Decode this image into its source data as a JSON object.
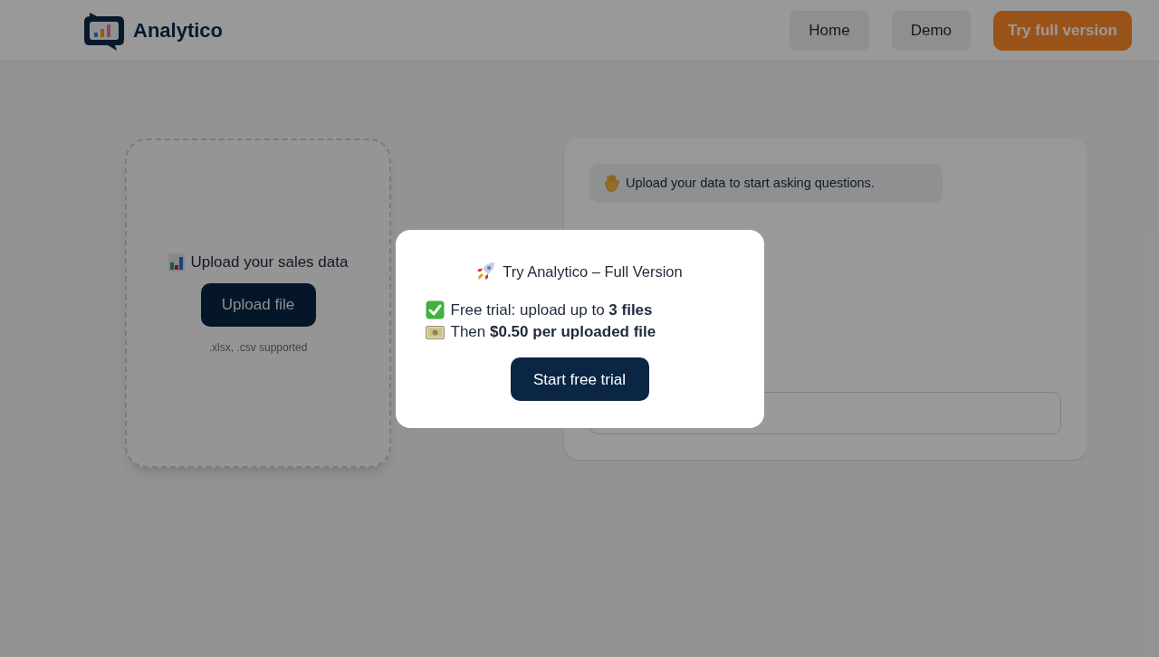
{
  "header": {
    "brand": "Analytico",
    "nav": [
      {
        "label": "Home",
        "kind": "link"
      },
      {
        "label": "Demo",
        "kind": "link"
      },
      {
        "label": "Try full version",
        "kind": "cta"
      }
    ]
  },
  "upload_card": {
    "title": "Upload your sales data",
    "button": "Upload file",
    "hint": ".xlsx, .csv supported"
  },
  "chat": {
    "messages": [
      {
        "text": "Upload your data to start asking questions."
      }
    ]
  },
  "modal": {
    "title": "Try Analytico – Full Version",
    "features": [
      {
        "text": "Free trial: upload up to **3 files**"
      },
      {
        "text": "Then **$0.50 per uploaded file**"
      }
    ],
    "button": "Start free trial"
  }
}
